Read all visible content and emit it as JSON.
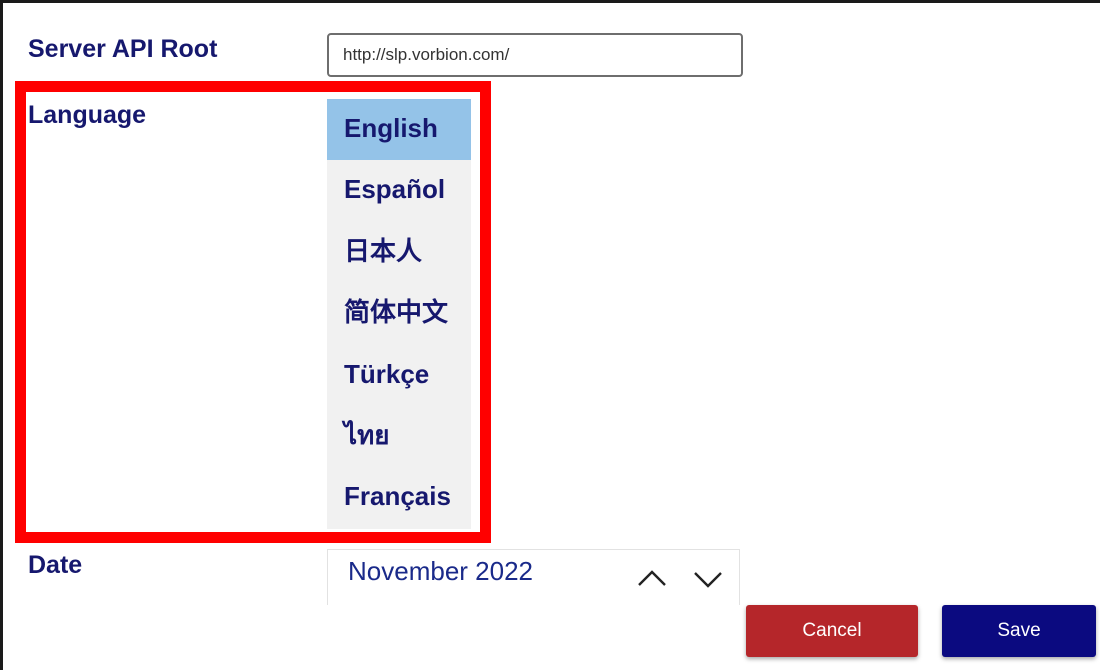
{
  "colors": {
    "label_text": "#16186e",
    "highlight_border": "#ff0000",
    "selected_item_bg": "#94c3e8",
    "list_bg": "#f1f1f1",
    "cancel_bg": "#b5262a",
    "save_bg": "#0b0a80"
  },
  "server_api": {
    "label": "Server API Root",
    "value": "http://slp.vorbion.com/"
  },
  "language": {
    "label": "Language",
    "selected": "English",
    "options": [
      "English",
      "Español",
      "日本人",
      "简体中文",
      "Türkçe",
      "ไทย",
      "Français"
    ]
  },
  "date": {
    "label": "Date",
    "value": "November 2022",
    "up_icon": "chevron-up-icon",
    "down_icon": "chevron-down-icon"
  },
  "actions": {
    "cancel_label": "Cancel",
    "save_label": "Save"
  }
}
